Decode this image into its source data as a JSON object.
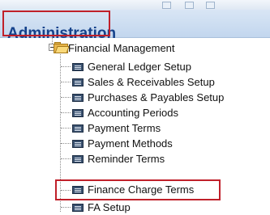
{
  "header": {
    "title": "Administration"
  },
  "tree": {
    "folder": {
      "label": "Financial Management",
      "icon": "folder-open-icon",
      "expanded": true
    },
    "items": [
      {
        "label": "General Ledger Setup",
        "icon": "form-icon"
      },
      {
        "label": "Sales & Receivables Setup",
        "icon": "form-icon"
      },
      {
        "label": "Purchases & Payables Setup",
        "icon": "form-icon"
      },
      {
        "label": "Accounting Periods",
        "icon": "form-icon"
      },
      {
        "label": "Payment Terms",
        "icon": "form-icon"
      },
      {
        "label": "Payment Methods",
        "icon": "form-icon"
      },
      {
        "label": "Reminder Terms",
        "icon": "form-icon"
      },
      {
        "label": "Finance Charge Terms",
        "icon": "form-icon",
        "highlighted": true
      },
      {
        "label": "FA Setup",
        "icon": "form-icon"
      }
    ]
  },
  "colors": {
    "header_text": "#15428b",
    "highlight_border": "#c0202a",
    "header_bg": "#c2d6ee"
  }
}
